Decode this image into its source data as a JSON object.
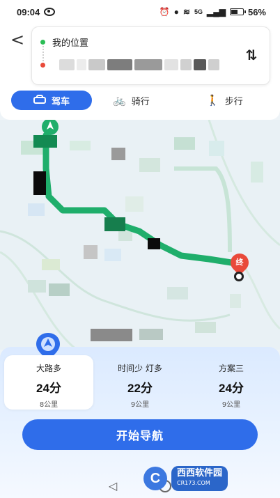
{
  "status_bar": {
    "time": "09:04",
    "network": "5G",
    "battery": "56%",
    "battery_level": 0.56
  },
  "route": {
    "start_label": "我的位置",
    "end_label": "",
    "swap_icon": "swap-icon",
    "back_icon": "back-icon"
  },
  "modes": [
    {
      "label": "驾车",
      "icon": "car-icon",
      "active": true
    },
    {
      "label": "骑行",
      "icon": "bicycle-icon",
      "active": false
    },
    {
      "label": "步行",
      "icon": "walk-icon",
      "active": false
    }
  ],
  "map": {
    "end_marker_text": "终"
  },
  "plans": [
    {
      "name": "大路多",
      "time": "24分",
      "distance": "8公里",
      "active": true
    },
    {
      "name": "时间少 灯多",
      "time": "22分",
      "distance": "9公里",
      "active": false
    },
    {
      "name": "方案三",
      "time": "24分",
      "distance": "9公里",
      "active": false
    }
  ],
  "start_button": "开始导航",
  "watermark": {
    "logo": "C",
    "name": "西西软件园",
    "url": "CR173.COM"
  },
  "colors": {
    "accent": "#2f6dea",
    "route_green": "#1fae6b",
    "start_dot": "#2bbd55",
    "end_dot": "#e94a3a"
  }
}
